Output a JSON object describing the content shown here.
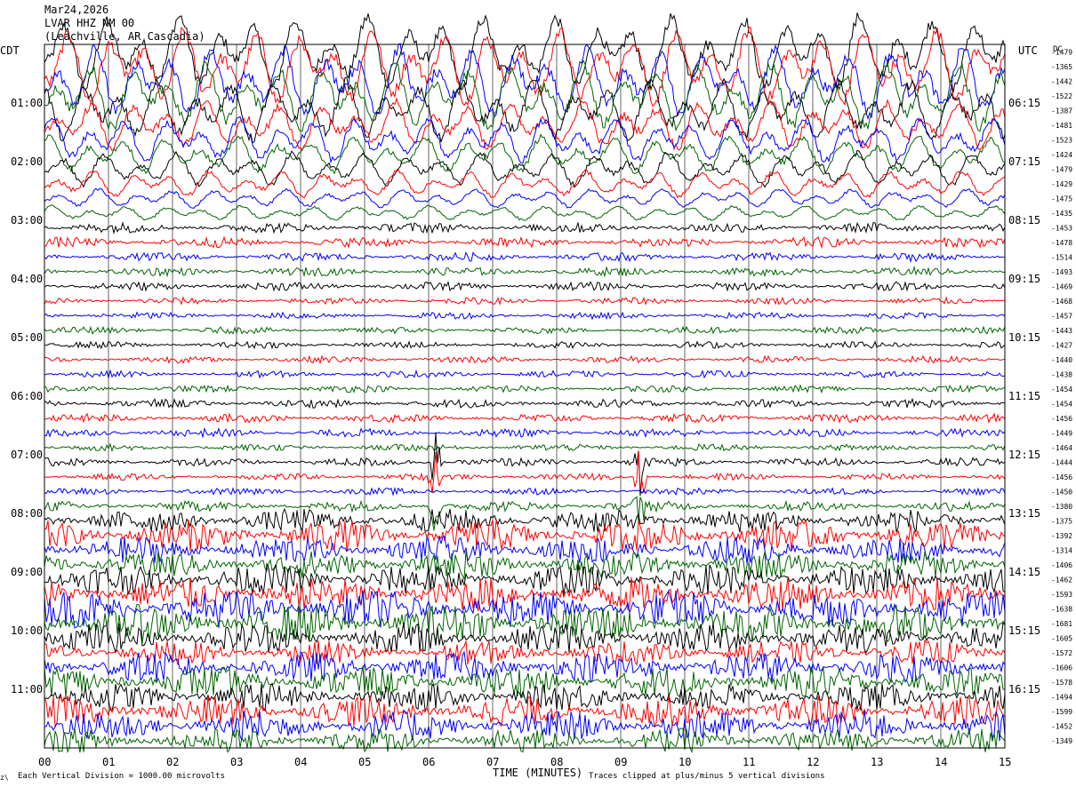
{
  "header": {
    "date": "Mar24,2026",
    "station": "LVAR HHZ NM 00",
    "location": "(Leachville, AR Cascadia)"
  },
  "axes": {
    "left_timezone": "CDT",
    "right_timezone": "UTC",
    "dc_label": "DC",
    "x_title": "TIME (MINUTES)",
    "footer_left": "Each Vertical Division = 1000.00 microvolts",
    "footer_right": "Traces clipped at plus/minus 5 vertical divisions",
    "corner_mark": "z\\"
  },
  "chart_data": {
    "type": "line",
    "title": "",
    "xlabel": "TIME (MINUTES)",
    "ylabel": "",
    "xlim": [
      0,
      15
    ],
    "x_ticks": [
      "00",
      "01",
      "02",
      "03",
      "04",
      "05",
      "06",
      "07",
      "08",
      "09",
      "10",
      "11",
      "12",
      "13",
      "14",
      "15"
    ],
    "grid": "vertical lines every minute",
    "row_count": 48,
    "trace_colors": [
      "#000000",
      "#ff0000",
      "#0000ff",
      "#006400"
    ],
    "left_time_labels": [
      "01:00",
      "02:00",
      "03:00",
      "04:00",
      "05:00",
      "06:00",
      "07:00",
      "08:00",
      "09:00",
      "10:00",
      "11:00"
    ],
    "right_time_labels": [
      "06:15",
      "07:15",
      "08:15",
      "09:15",
      "10:15",
      "11:15",
      "12:15",
      "13:15",
      "14:15",
      "15:15",
      "16:15"
    ],
    "dc_offsets": [
      -1479,
      -1365,
      -1442,
      -1522,
      -1387,
      -1481,
      -1523,
      -1424,
      -1479,
      -1429,
      -1475,
      -1435,
      -1453,
      -1478,
      -1514,
      -1493,
      -1469,
      -1468,
      -1457,
      -1443,
      -1427,
      -1440,
      -1438,
      -1454,
      -1454,
      -1456,
      -1449,
      -1464,
      -1444,
      -1456,
      -1450,
      -1380,
      -1375,
      -1392,
      -1314,
      -1406,
      -1462,
      -1593,
      -1638,
      -1681,
      -1605,
      -1572,
      -1606,
      -1578,
      -1494,
      -1599,
      -1452,
      -1349
    ],
    "amplitude_profile": [
      40,
      40,
      38,
      36,
      32,
      26,
      24,
      20,
      18,
      14,
      10,
      8,
      6,
      6,
      5,
      5,
      5,
      4,
      4,
      4,
      4,
      4,
      4,
      4,
      5,
      5,
      5,
      4,
      5,
      4,
      4,
      6,
      14,
      18,
      16,
      16,
      18,
      20,
      22,
      22,
      18,
      14,
      18,
      18,
      16,
      18,
      18,
      14
    ],
    "events": [
      {
        "minute": 6.1,
        "label": "spike near 07:15 row"
      },
      {
        "minute": 9.3,
        "label": "spike near 07:15 row"
      }
    ],
    "clipping": "plus/minus 5 vertical divisions",
    "vertical_division": "1000.00 microvolts"
  }
}
